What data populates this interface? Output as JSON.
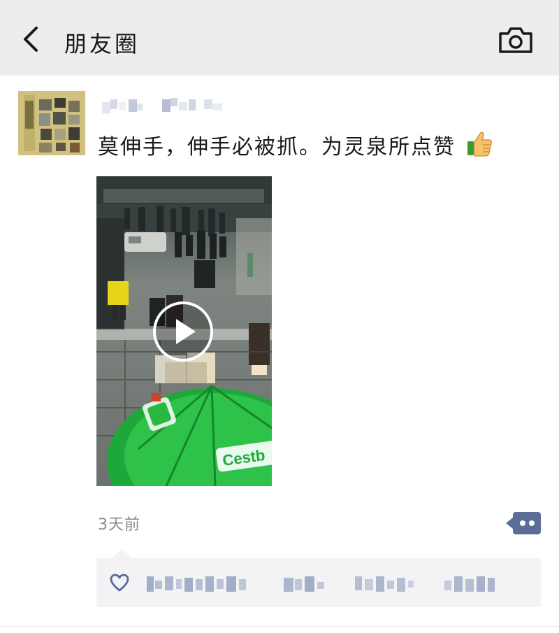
{
  "header": {
    "back_icon": "chevron-left-icon",
    "title": "朋友圈",
    "camera_icon": "camera-icon"
  },
  "post": {
    "author_name_visible": false,
    "text": "莫伸手，伸手必被抓。为灵泉所点赞",
    "emoji": "thumbs-up-icon",
    "media": {
      "type": "video",
      "play_icon": "play-icon",
      "overlay_text": "Cestb"
    },
    "time": "3天前",
    "more_icon": "comment-more-icon",
    "likes": {
      "heart_icon": "heart-icon"
    }
  },
  "colors": {
    "topbar_bg": "#ededed",
    "like_bg": "#f3f3f5",
    "link_blue": "#576b95",
    "time_gray": "#8a8a8a"
  }
}
